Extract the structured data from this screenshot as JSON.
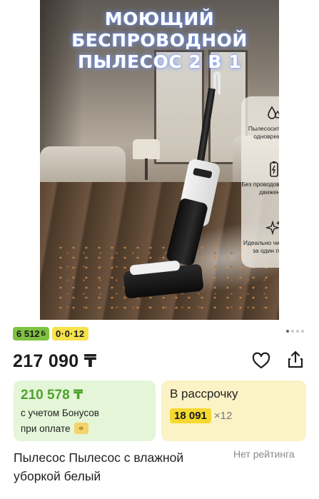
{
  "hero": {
    "title_lines": [
      "МОЮЩИЙ",
      "БЕСПРОВОДНОЙ",
      "ПЫЛЕСОС 2 В 1"
    ],
    "features": [
      {
        "icon": "water-drops-icon",
        "text": "Пылесосит и моет одновременно"
      },
      {
        "icon": "battery-icon",
        "text": "Без проводов (свобода движений)"
      },
      {
        "icon": "sparkles-icon",
        "text": "Идеально чистый пол за один проход"
      }
    ]
  },
  "badges": {
    "bonus": "6 512",
    "bonus_currency": "Б",
    "installment": "0·0·12"
  },
  "gallery": {
    "pages": 4,
    "active": 0
  },
  "price": {
    "current": "217 090 ₸"
  },
  "bonus_card": {
    "price": "210 578 ₸",
    "line1": "с учетом Бонусов",
    "line2": "при оплате"
  },
  "installment_card": {
    "title": "В рассрочку",
    "amount": "18 091",
    "multiplier": "×12"
  },
  "product": {
    "title": "Пылесос Пылесос с влажной уборкой белый",
    "rating": "Нет рейтинга"
  },
  "colors": {
    "bonus_green": "#7fc241",
    "installment_yellow": "#f6e24a",
    "bonus_card_bg": "#e5f5d8",
    "installment_card_bg": "#fbf2c6"
  }
}
